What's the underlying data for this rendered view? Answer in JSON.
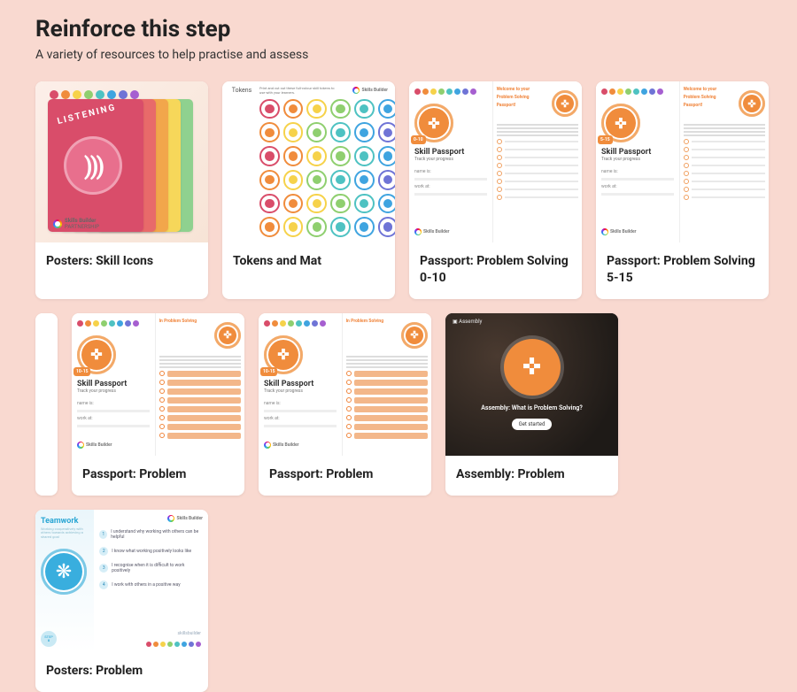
{
  "header": {
    "title": "Reinforce this step",
    "subtitle": "A variety of resources to help practise and assess"
  },
  "brand": {
    "name": "Skills Builder",
    "subname": "PARTNERSHIP",
    "site": "skillsbuilder"
  },
  "skill_colors": [
    "#d94d6a",
    "#f08c3c",
    "#f6d24a",
    "#8fcf6f",
    "#4ec2c2",
    "#3fa4e0",
    "#6f74d6",
    "#a65fd0"
  ],
  "passport_common": {
    "title": "Skill Passport",
    "subtitle": "Track your progress",
    "welcome_1": "Welcome to your",
    "welcome_2": "Problem Solving",
    "welcome_3": "Passport!",
    "right_heading": "In Problem Solving",
    "name_label": "name is:",
    "work_label": "work at:"
  },
  "cards": [
    {
      "title": "Posters: Skill Icons",
      "kind": "posters",
      "badge_text": "LISTENING"
    },
    {
      "title": "Tokens and Mat",
      "kind": "tokens",
      "side_label": "Tokens"
    },
    {
      "title": "Passport: Problem Solving 0-10",
      "kind": "passport",
      "range": "0-10",
      "style": "plain"
    },
    {
      "title": "Passport: Problem Solving 5-15",
      "kind": "passport",
      "range": "5-15",
      "style": "plain"
    },
    {
      "title": "Passport: Problem",
      "kind": "passport",
      "range": "10-15",
      "style": "filled"
    },
    {
      "title": "Passport: Problem",
      "kind": "passport",
      "range": "10-15",
      "style": "filled"
    },
    {
      "title": "Assembly: Problem",
      "kind": "assembly",
      "tag": "Assembly",
      "caption": "Assembly: What is Problem Solving?",
      "button": "Get started"
    },
    {
      "title": "Posters: Problem",
      "kind": "teamwork",
      "heading": "Teamwork",
      "subheading": "Working cooperatively with others towards achieving a shared goal",
      "step_label": "STEP",
      "step_num": "0",
      "rows": [
        {
          "n": "1",
          "t": "I understand why working with others can be helpful"
        },
        {
          "n": "2",
          "t": "I know what working positively looks like"
        },
        {
          "n": "3",
          "t": "I recognise when it is difficult to work positively"
        },
        {
          "n": "4",
          "t": "I work with others in a positive way"
        }
      ]
    }
  ]
}
